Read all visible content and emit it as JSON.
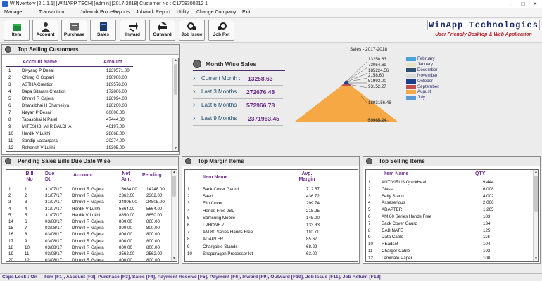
{
  "titlebar": {
    "text": "WINventory [2.1.1.1] [WINAPP TECH] [admin] [2017-2018] Customer No : C1708300212 1",
    "minimize": "–",
    "maximize": "□",
    "close": "✕"
  },
  "menu": [
    "Manage",
    "Transaction",
    "Jobwork Process",
    "Reports",
    "Jobwork Report",
    "Utility",
    "Change Company",
    "Exit"
  ],
  "toolbar": [
    {
      "label": "Item",
      "icon": "box-icon"
    },
    {
      "label": "Account",
      "icon": "person-icon"
    },
    {
      "label": "Purchase",
      "icon": "cart-icon"
    },
    {
      "label": "Sales",
      "icon": "sales-icon"
    },
    {
      "label": "Inward",
      "icon": "inward-icon"
    },
    {
      "label": "Outward",
      "icon": "outward-icon"
    },
    {
      "label": "Job Issue",
      "icon": "job-issue-icon"
    },
    {
      "label": "Job Ret",
      "icon": "job-return-icon"
    }
  ],
  "brand": {
    "name": "WinApp Technologies",
    "tagline": "User Friendly Desktop & Web Application"
  },
  "top_customers": {
    "title": "Top Selling Customers",
    "headers": [
      "Account Name",
      "Amount"
    ],
    "rows": [
      [
        "1",
        "Divyang P Desai",
        "1239571.00"
      ],
      [
        "2",
        "Chirag G Gopani",
        "190900.00"
      ],
      [
        "3",
        "ASTHA Creation",
        "189578.00"
      ],
      [
        "4",
        "Bapa Sitaram Creation",
        "172806.00"
      ],
      [
        "5",
        "Dhruvil R Gajera",
        "126994.00"
      ],
      [
        "6",
        "Bharatbhai H Dhameliya",
        "120200.00"
      ],
      [
        "7",
        "Nayan P Desai",
        "60000.00"
      ],
      [
        "8",
        "Tapasbhai N Patel",
        "47444.00"
      ],
      [
        "9",
        "MITESHBHAI R BALDHA",
        "46197.00"
      ],
      [
        "10",
        "Hardik V Lukhi",
        "28668.00"
      ],
      [
        "11",
        "Sandip Vastarpara",
        "20274.00"
      ],
      [
        "12",
        "Rehansh V Lukhi",
        "19305.00"
      ]
    ]
  },
  "month_sales": {
    "title": "Month Wise Sales",
    "rows": [
      {
        "label": "Current Month :",
        "value": "13258.63"
      },
      {
        "label": "Last 3 Months :",
        "value": "272676.48"
      },
      {
        "label": "Last 6 Months :",
        "value": "572966.78"
      },
      {
        "label": "Last 9 Months :",
        "value": "2371963.45"
      }
    ]
  },
  "chart_data": {
    "type": "pyramid",
    "title": "Sales - 2017-2018",
    "series": [
      {
        "name": "February",
        "value": 13258.63,
        "color": "#4aa3d6"
      },
      {
        "name": "January",
        "value": 73054.69,
        "color": "#e8e3c6"
      },
      {
        "name": "December",
        "value": 185224.56,
        "color": "#2f4f6f"
      },
      {
        "name": "November",
        "value": 2158.6,
        "color": "#d9d9d9"
      },
      {
        "name": "October",
        "value": 51993.0,
        "color": "#1c3f8c"
      },
      {
        "name": "September",
        "value": 93152.27,
        "color": "#c0504d"
      },
      {
        "name": "August",
        "value": 1893156.46,
        "color": "#f5a843"
      },
      {
        "name": "July",
        "value": 59965.24,
        "color": "#5b9bd5"
      }
    ],
    "labels": [
      "13258.63",
      "73054.69",
      "185224.56",
      "2158.60",
      "51993.00",
      "93152.27",
      "1893156.46",
      "59965.24"
    ],
    "legend": "right"
  },
  "pending_bills": {
    "title": "Pending Sales Bills Due Date Wise",
    "headers": [
      "Bill No",
      "Due Dt.",
      "Account",
      "Net Amt",
      "Pending"
    ],
    "rows": [
      [
        "1",
        "31/07/17",
        "Dhruvil R Gajera",
        "15684.00",
        "14248.00"
      ],
      [
        "2",
        "31/07/17",
        "Dhruvil R Gajera",
        "2362.00",
        "2362.00"
      ],
      [
        "3",
        "31/07/17",
        "Dhruvil R Gajera",
        "24805.00",
        "24805.00"
      ],
      [
        "4",
        "31/07/17",
        "Hardik V Lukhi",
        "5664.00",
        "5664.00"
      ],
      [
        "5",
        "31/07/17",
        "Hardik V Lukhi",
        "8850.00",
        "8850.00"
      ],
      [
        "6",
        "03/08/17",
        "Dhruvil R Gajera",
        "800.00",
        "800.00"
      ],
      [
        "7",
        "03/08/17",
        "Dhruvil R Gajera",
        "800.00",
        "800.00"
      ],
      [
        "8",
        "03/08/17",
        "Dhruvil R Gajera",
        "800.00",
        "800.00"
      ],
      [
        "9",
        "03/08/17",
        "Dhruvil R Gajera",
        "800.00",
        "800.00"
      ],
      [
        "10",
        "03/08/17",
        "Dhruvil R Gajera",
        "800.00",
        "800.00"
      ],
      [
        "11",
        "03/08/17",
        "Dhruvil R Gajera",
        "2562.00",
        "2562.00"
      ],
      [
        "12",
        "03/08/17",
        "Dhruvil R Gajera",
        "800.00",
        "800.00"
      ]
    ],
    "col_nums": [
      "1",
      "2",
      "3",
      "4",
      "5",
      "14",
      "15",
      "16",
      "17",
      "18",
      "19",
      "20"
    ]
  },
  "top_margin": {
    "title": "Top Margin Items",
    "headers": [
      "Item Name",
      "Avg. Margin"
    ],
    "rows": [
      [
        "1",
        "Back Cover Gaurd",
        "712.57"
      ],
      [
        "2",
        "Saari",
        "436.72"
      ],
      [
        "3",
        "Flip Cover",
        "299.74"
      ],
      [
        "4",
        "Hands Free JBL",
        "218.25"
      ],
      [
        "5",
        "Samsung Mobile",
        "145.00"
      ],
      [
        "6",
        "I PHONE 7",
        "133.33"
      ],
      [
        "7",
        "AM 80 Series Hands Free",
        "110.71"
      ],
      [
        "8",
        "ADAPTER",
        "85.67"
      ],
      [
        "9",
        "Chargable Stands",
        "68.29"
      ],
      [
        "10",
        "Snapdragon Processor kit",
        "63.00"
      ]
    ]
  },
  "top_items": {
    "title": "Top Selling Items",
    "headers": [
      "Item Name",
      "QTY"
    ],
    "rows": [
      [
        "1",
        "ANTIVIRUS QuickHeal",
        "9,444"
      ],
      [
        "2",
        "Glass",
        "6,008"
      ],
      [
        "3",
        "Selfy Stand",
        "4,002"
      ],
      [
        "4",
        "Asseserious",
        "2,006"
      ],
      [
        "5",
        "ADAPTER",
        "1,265"
      ],
      [
        "6",
        "AM 80 Series Hands Free",
        "183"
      ],
      [
        "7",
        "Back Cover Gaurd",
        "134"
      ],
      [
        "8",
        "CABINATE",
        "125"
      ],
      [
        "9",
        "Data Cable",
        "116"
      ],
      [
        "10",
        "HEadset",
        "104"
      ],
      [
        "11",
        "Charger Cable",
        "102"
      ],
      [
        "12",
        "Laminate Paper",
        "100"
      ]
    ]
  },
  "status": {
    "caps": "Caps Lock : On",
    "shortcuts": "Item [F1], Account [F2], Purchase [F3], Sales [F4], Payment Receive [F5], Payment [F6], Inward [F9], Outward [F10], Job Issue [F11], Job Return [F12]"
  }
}
